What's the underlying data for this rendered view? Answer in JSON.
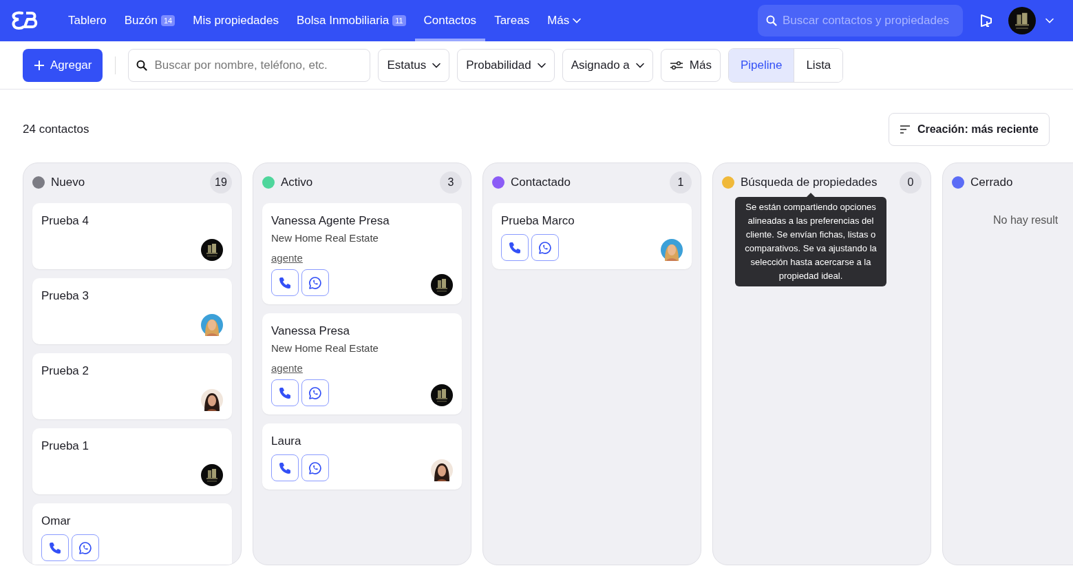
{
  "nav": {
    "items": [
      {
        "label": "Tablero",
        "selected": false
      },
      {
        "label": "Buzón",
        "badge": "14",
        "selected": false
      },
      {
        "label": "Mis propiedades",
        "selected": false
      },
      {
        "label": "Bolsa Inmobiliaria",
        "badge": "11",
        "selected": false
      },
      {
        "label": "Contactos",
        "selected": true
      },
      {
        "label": "Tareas",
        "selected": false
      },
      {
        "label": "Más",
        "kind": "menu",
        "selected": false
      }
    ],
    "search": {
      "placeholder": "Buscar contactos y propiedades"
    }
  },
  "toolbar": {
    "add_button": "Agregar",
    "search": {
      "placeholder": "Buscar por nombre, teléfono, etc."
    },
    "filters": [
      "Estatus",
      "Probabilidad",
      "Asignado a"
    ],
    "more_button": "Más",
    "views": [
      {
        "label": "Pipeline",
        "selected": true
      },
      {
        "label": "Lista",
        "selected": false
      }
    ]
  },
  "summary": {
    "count": "24 contactos",
    "sort": "Creación: más reciente"
  },
  "columns": [
    {
      "title": "Nuevo",
      "color": "#7c7c84",
      "count": "19",
      "cards": [
        {
          "name": "Prueba 4",
          "contact_buttons": false,
          "avatar": {
            "kind": "logo"
          }
        },
        {
          "name": "Prueba 3",
          "contact_buttons": false,
          "avatar": {
            "kind": "blonde"
          }
        },
        {
          "name": "Prueba 2",
          "contact_buttons": false,
          "avatar": {
            "kind": "brunette"
          }
        },
        {
          "name": "Prueba 1",
          "contact_buttons": false,
          "avatar": {
            "kind": "logo"
          }
        },
        {
          "name": "Omar",
          "contact_buttons": true
        }
      ]
    },
    {
      "title": "Activo",
      "color": "#4fd69c",
      "count": "3",
      "cards": [
        {
          "name": "Vanessa Agente Presa",
          "company": "New Home Real Estate",
          "tag": "agente",
          "contact_buttons": true,
          "avatar": {
            "kind": "logo"
          }
        },
        {
          "name": "Vanessa Presa",
          "company": "New Home Real Estate",
          "tag": "agente",
          "contact_buttons": true,
          "avatar": {
            "kind": "logo"
          }
        },
        {
          "name": "Laura",
          "contact_buttons": true,
          "avatar": {
            "kind": "brunette"
          }
        }
      ]
    },
    {
      "title": "Contactado",
      "color": "#8b5cf6",
      "count": "1",
      "cards": [
        {
          "name": "Prueba Marco",
          "contact_buttons": true,
          "avatar": {
            "kind": "blonde"
          }
        }
      ]
    },
    {
      "title": "Búsqueda de propiedades",
      "color": "#f0b93a",
      "count": "0",
      "tooltip": "Se están compartiendo opciones alineadas a las preferencias del cliente. Se envían fichas, listas o comparativos. Se va ajustando la selección hasta acercarse a la propiedad ideal."
    },
    {
      "title": "Cerrado",
      "color": "#5b6cf6",
      "empty": "No hay result"
    }
  ]
}
